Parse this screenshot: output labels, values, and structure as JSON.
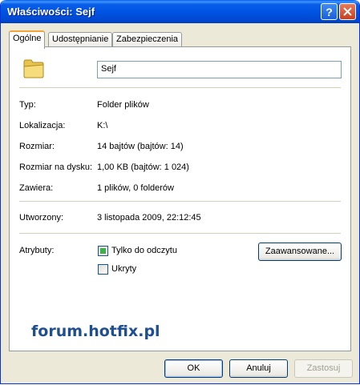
{
  "window": {
    "title": "Właściwości: Sejf"
  },
  "titlebar": {
    "help_label": "?"
  },
  "tabs": [
    {
      "label": "Ogólne",
      "active": true
    },
    {
      "label": "Udostępnianie"
    },
    {
      "label": "Zabezpieczenia"
    }
  ],
  "general": {
    "name": "Sejf",
    "rows": [
      {
        "label": "Typ:",
        "value": "Folder plików"
      },
      {
        "label": "Lokalizacja:",
        "value": "K:\\"
      },
      {
        "label": "Rozmiar:",
        "value": "14 bajtów (bajtów: 14)"
      },
      {
        "label": "Rozmiar na dysku:",
        "value": "1,00 KB (bajtów: 1 024)"
      },
      {
        "label": "Zawiera:",
        "value": "1 plików, 0 folderów"
      }
    ],
    "created_label": "Utworzony:",
    "created_value": "3 listopada 2009, 22:12:45",
    "attributes_label": "Atrybuty:",
    "readonly_label": "Tylko do odczytu",
    "hidden_label": "Ukryty",
    "advanced_label": "Zaawansowane..."
  },
  "watermark": "forum.hotfix.pl",
  "buttons": {
    "ok": "OK",
    "cancel": "Anuluj",
    "apply": "Zastosuj"
  },
  "colors": {
    "titlebar": "#0054e3",
    "tab_highlight": "#f1a537",
    "watermark": "#1f4f8f"
  }
}
